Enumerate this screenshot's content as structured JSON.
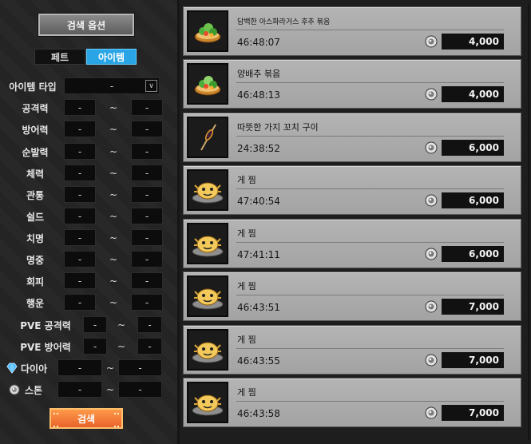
{
  "panel": {
    "title": "검색 옵션",
    "tabs": [
      {
        "label": "페트",
        "active": false
      },
      {
        "label": "아이템",
        "active": true
      }
    ],
    "item_type": {
      "label": "아이템 타입",
      "value": "-"
    },
    "range_filters": [
      {
        "label": "공격력",
        "min": "-",
        "sep": "~",
        "max": "-"
      },
      {
        "label": "방어력",
        "min": "-",
        "sep": "~",
        "max": "-"
      },
      {
        "label": "순발력",
        "min": "-",
        "sep": "~",
        "max": "-"
      },
      {
        "label": "체력",
        "min": "-",
        "sep": "~",
        "max": "-"
      },
      {
        "label": "관통",
        "min": "-",
        "sep": "~",
        "max": "-"
      },
      {
        "label": "쉴드",
        "min": "-",
        "sep": "~",
        "max": "-"
      },
      {
        "label": "치명",
        "min": "-",
        "sep": "~",
        "max": "-"
      },
      {
        "label": "명중",
        "min": "-",
        "sep": "~",
        "max": "-"
      },
      {
        "label": "회피",
        "min": "-",
        "sep": "~",
        "max": "-"
      },
      {
        "label": "행운",
        "min": "-",
        "sep": "~",
        "max": "-"
      }
    ],
    "pve_filters": [
      {
        "label": "PVE 공격력",
        "min": "-",
        "sep": "~",
        "max": "-"
      },
      {
        "label": "PVE 방어력",
        "min": "-",
        "sep": "~",
        "max": "-"
      }
    ],
    "currency_filters": [
      {
        "label": "다이아",
        "icon": "diamond-icon",
        "min": "-",
        "sep": "~",
        "max": "-"
      },
      {
        "label": "스톤",
        "icon": "stone-icon",
        "min": "-",
        "sep": "~",
        "max": "-"
      }
    ],
    "search_button": "검색"
  },
  "listings": [
    {
      "name": "담백한 아스파라거스 후추 볶음",
      "time": "46:48:07",
      "price": "4,000",
      "icon": "stir-fry-dish-icon"
    },
    {
      "name": "양배추 볶음",
      "time": "46:48:13",
      "price": "4,000",
      "icon": "stir-fry-dish-icon"
    },
    {
      "name": "따뜻한 가지 꼬치 구이",
      "time": "24:38:52",
      "price": "6,000",
      "icon": "skewer-icon"
    },
    {
      "name": "게 찜",
      "time": "47:40:54",
      "price": "6,000",
      "icon": "steamed-crab-icon"
    },
    {
      "name": "게 찜",
      "time": "47:41:11",
      "price": "6,000",
      "icon": "steamed-crab-icon"
    },
    {
      "name": "게 찜",
      "time": "46:43:51",
      "price": "7,000",
      "icon": "steamed-crab-icon"
    },
    {
      "name": "게 찜",
      "time": "46:43:55",
      "price": "7,000",
      "icon": "steamed-crab-icon"
    },
    {
      "name": "게 찜",
      "time": "46:43:58",
      "price": "7,000",
      "icon": "steamed-crab-icon"
    }
  ],
  "colors": {
    "tab_active": "#29a5e6",
    "search_button": "#f07a35",
    "card_bg": "#ababab",
    "price_bg": "#111111"
  }
}
